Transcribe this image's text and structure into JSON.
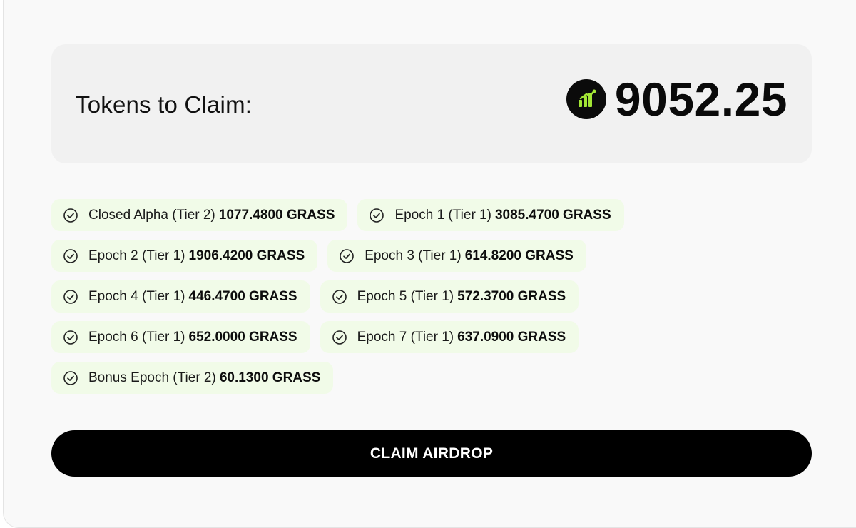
{
  "claim": {
    "label": "Tokens to Claim:",
    "amount": "9052.25",
    "token_icon": "grass-logo-icon",
    "accent": "#a3e635"
  },
  "rewards": [
    {
      "name": "Closed Alpha (Tier 2)",
      "amount": "1077.4800 GRASS"
    },
    {
      "name": "Epoch 1 (Tier 1)",
      "amount": "3085.4700 GRASS"
    },
    {
      "name": "Epoch 2 (Tier 1)",
      "amount": "1906.4200 GRASS"
    },
    {
      "name": "Epoch 3 (Tier 1)",
      "amount": "614.8200 GRASS"
    },
    {
      "name": "Epoch 4 (Tier 1)",
      "amount": "446.4700 GRASS"
    },
    {
      "name": "Epoch 5 (Tier 1)",
      "amount": "572.3700 GRASS"
    },
    {
      "name": "Epoch 6 (Tier 1)",
      "amount": "652.0000 GRASS"
    },
    {
      "name": "Epoch 7 (Tier 1)",
      "amount": "637.0900 GRASS"
    },
    {
      "name": "Bonus Epoch (Tier 2)",
      "amount": "60.1300 GRASS"
    }
  ],
  "reward_icon": "check-circle-icon",
  "chip_color": "#f1fbe8",
  "button": {
    "label": "CLAIM AIRDROP"
  }
}
